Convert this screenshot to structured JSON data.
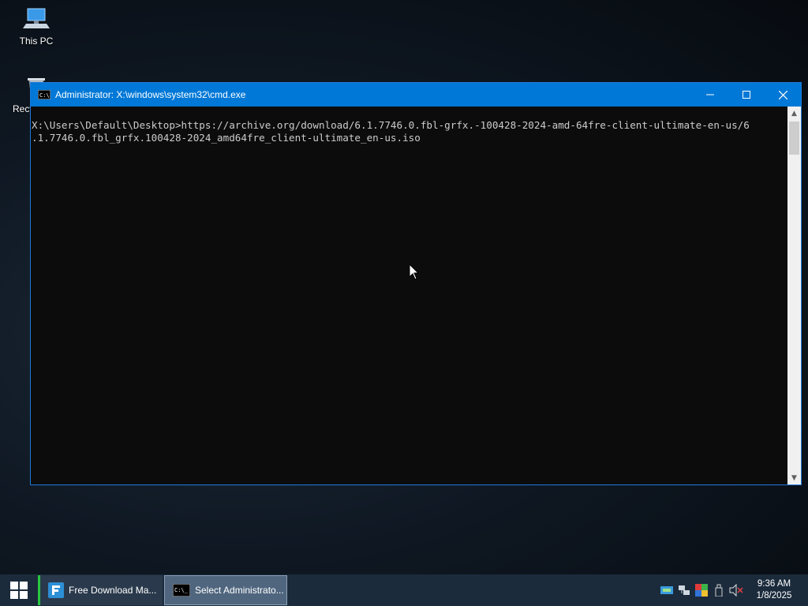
{
  "desktop": {
    "icons": [
      {
        "label": "This PC"
      },
      {
        "label": "Recy"
      }
    ]
  },
  "window": {
    "title": "Administrator: X:\\windows\\system32\\cmd.exe",
    "console_lines": [
      "X:\\Users\\Default\\Desktop>https://archive.org/download/6.1.7746.0.fbl-grfx.-100428-2024-amd-64fre-client-ultimate-en-us/6",
      ".1.7746.0.fbl_grfx.100428-2024_amd64fre_client-ultimate_en-us.iso"
    ]
  },
  "taskbar": {
    "items": [
      {
        "label": "Free Download Ma..."
      },
      {
        "label": "Select Administrato..."
      }
    ],
    "clock": {
      "time": "9:36 AM",
      "date": "1/8/2025"
    }
  },
  "colors": {
    "titlebar": "#0078d7",
    "console_bg": "#0c0c0c",
    "console_text": "#cccccc",
    "taskbar": "#1b2b3c"
  }
}
